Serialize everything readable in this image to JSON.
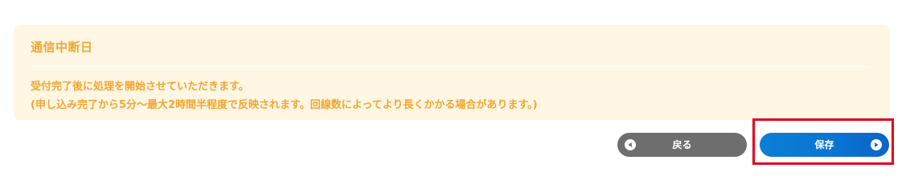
{
  "notice": {
    "title": "通信中断日",
    "line1": "受付完了後に処理を開始させていただきます。",
    "line2": "(申し込み完了から5分〜最大2時間半程度で反映されます。回線数によってより長くかかる場合があります。)"
  },
  "actions": {
    "back_label": "戻る",
    "save_label": "保存"
  },
  "icons": {
    "back": "chevron-left-circle-icon",
    "save": "chevron-right-circle-icon"
  },
  "colors": {
    "notice_bg": "#fff6e3",
    "notice_text": "#f2a630",
    "back_button": "#6e6e6e",
    "save_button": "#0a73d2",
    "highlight": "#e3001b"
  }
}
